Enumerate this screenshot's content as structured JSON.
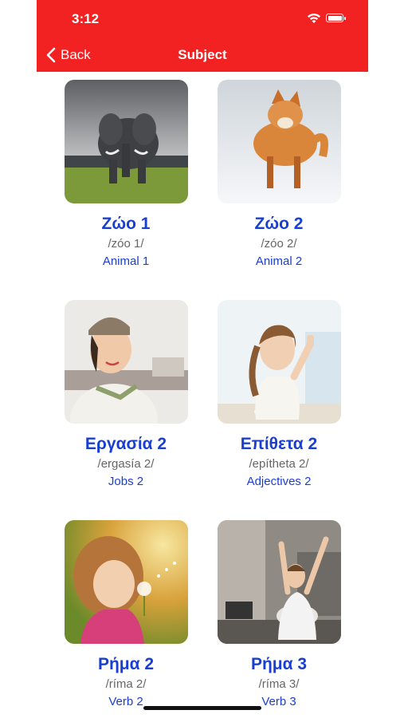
{
  "status": {
    "time": "3:12"
  },
  "nav": {
    "back_label": "Back",
    "title": "Subject"
  },
  "colors": {
    "header": "#f22222",
    "title_blue": "#1a3fd0"
  },
  "items": [
    {
      "title": "Ζώο 1",
      "pron": "/zóo 1/",
      "trans": "Animal 1",
      "image": "elephant-photo"
    },
    {
      "title": "Ζώο 2",
      "pron": "/zóo 2/",
      "trans": "Animal 2",
      "image": "fox-photo"
    },
    {
      "title": "Εργασία 2",
      "pron": "/ergasía 2/",
      "trans": "Jobs 2",
      "image": "flight-attendant-photo"
    },
    {
      "title": "Επίθετα 2",
      "pron": "/epítheta 2/",
      "trans": "Adjectives 2",
      "image": "girl-thumbs-up-photo"
    },
    {
      "title": "Ρήμα 2",
      "pron": "/ríma 2/",
      "trans": "Verb 2",
      "image": "girl-blowing-dandelion-photo"
    },
    {
      "title": "Ρήμα 3",
      "pron": "/ríma 3/",
      "trans": "Verb 3",
      "image": "woman-stretching-photo"
    }
  ]
}
